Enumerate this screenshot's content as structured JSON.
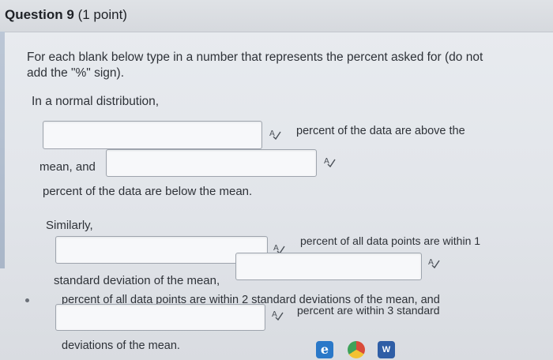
{
  "header": {
    "question_label": "Question 9",
    "points": "(1 point)"
  },
  "instructions": "For each blank below type in a number that represents the percent asked for (do not add the \"%\" sign).",
  "intro": "In a normal distribution,",
  "text": {
    "above_the": "percent of the data are above the",
    "mean_and": "mean, and",
    "below_mean": "percent of the data are below the mean.",
    "similarly": "Similarly,",
    "within1": "percent of all data points are within 1",
    "std_dev_mean": "standard deviation of the mean,",
    "within2": "percent of all data points are within 2 standard deviations of the mean, and",
    "within3": "percent are within 3 standard",
    "deviations_mean": "deviations of the mean."
  },
  "answers": {
    "above_mean": "",
    "below_mean": "",
    "within_1_sd": "",
    "within_2_sd": "",
    "within_3_sd": ""
  },
  "icons": [
    "spellcheck-icon",
    "edge-browser-icon",
    "chrome-icon",
    "word-icon"
  ],
  "taskbar": {
    "edge_glyph": "e",
    "word_glyph": "W"
  }
}
